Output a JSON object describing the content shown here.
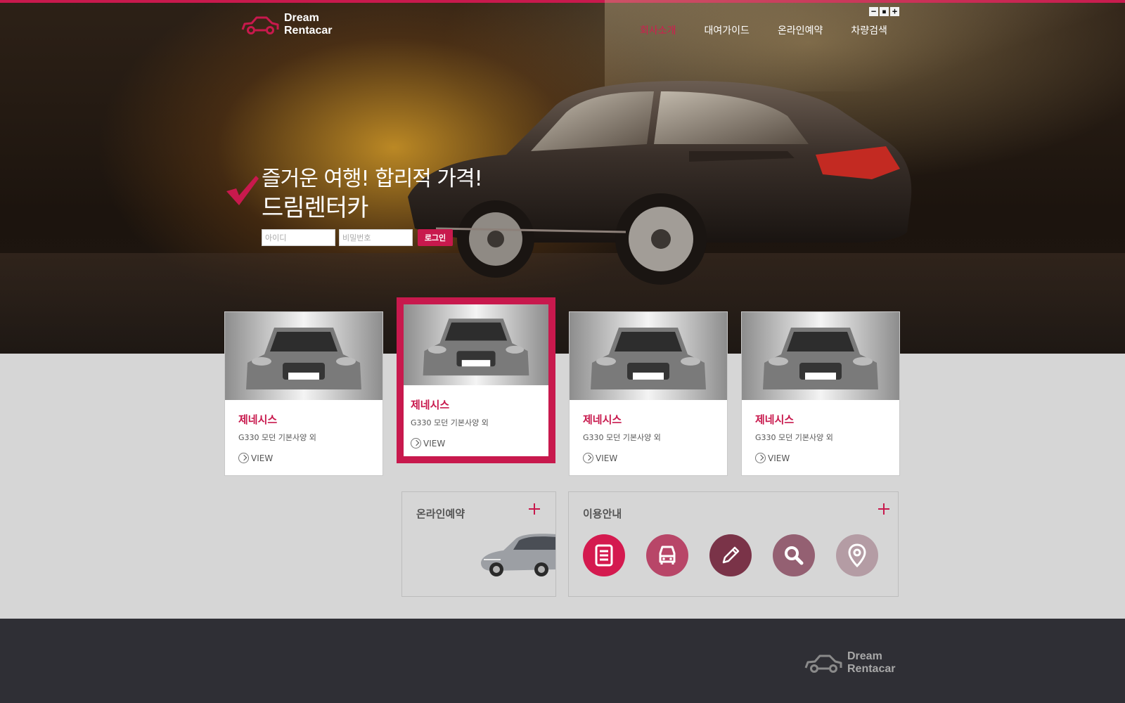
{
  "brand": {
    "line1": "Dream",
    "line2": "Rentacar",
    "accent_color": "#c8194d"
  },
  "nav": {
    "items": [
      {
        "label": "회사소개",
        "active": true
      },
      {
        "label": "대여가이드",
        "active": false
      },
      {
        "label": "온라인예약",
        "active": false
      },
      {
        "label": "차량검색",
        "active": false
      }
    ]
  },
  "zoom_controls": {
    "minus": "−",
    "reset": "▪",
    "plus": "+"
  },
  "hero": {
    "slogan_line1": "즐거운 여행! 합리적 가격!",
    "slogan_line2": "드림렌터카",
    "check_icon": "checkmark-icon"
  },
  "login": {
    "id_placeholder": "아이디",
    "password_placeholder": "비밀번호",
    "button_label": "로그인"
  },
  "cars": [
    {
      "title": "제네시스",
      "subtitle": "G330 모던 기본사양 외",
      "view": "VIEW",
      "featured": false
    },
    {
      "title": "제네시스",
      "subtitle": "G330 모던 기본사양 외",
      "view": "VIEW",
      "featured": true
    },
    {
      "title": "제네시스",
      "subtitle": "G330 모던 기본사양 외",
      "view": "VIEW",
      "featured": false
    },
    {
      "title": "제네시스",
      "subtitle": "G330 모던 기본사양 외",
      "view": "VIEW",
      "featured": false
    }
  ],
  "panels": {
    "reservation": {
      "title": "온라인예약"
    },
    "guide": {
      "title": "이용안내",
      "icons": [
        {
          "name": "document-icon",
          "color": "#d41a4f"
        },
        {
          "name": "car-front-icon",
          "color": "#b84668"
        },
        {
          "name": "pencil-icon",
          "color": "#7a3348"
        },
        {
          "name": "search-icon",
          "color": "#946072"
        },
        {
          "name": "location-pin-icon",
          "color": "#b49ca4"
        }
      ]
    }
  },
  "footer": {
    "logo_line1": "Dream",
    "logo_line2": "Rentacar"
  }
}
